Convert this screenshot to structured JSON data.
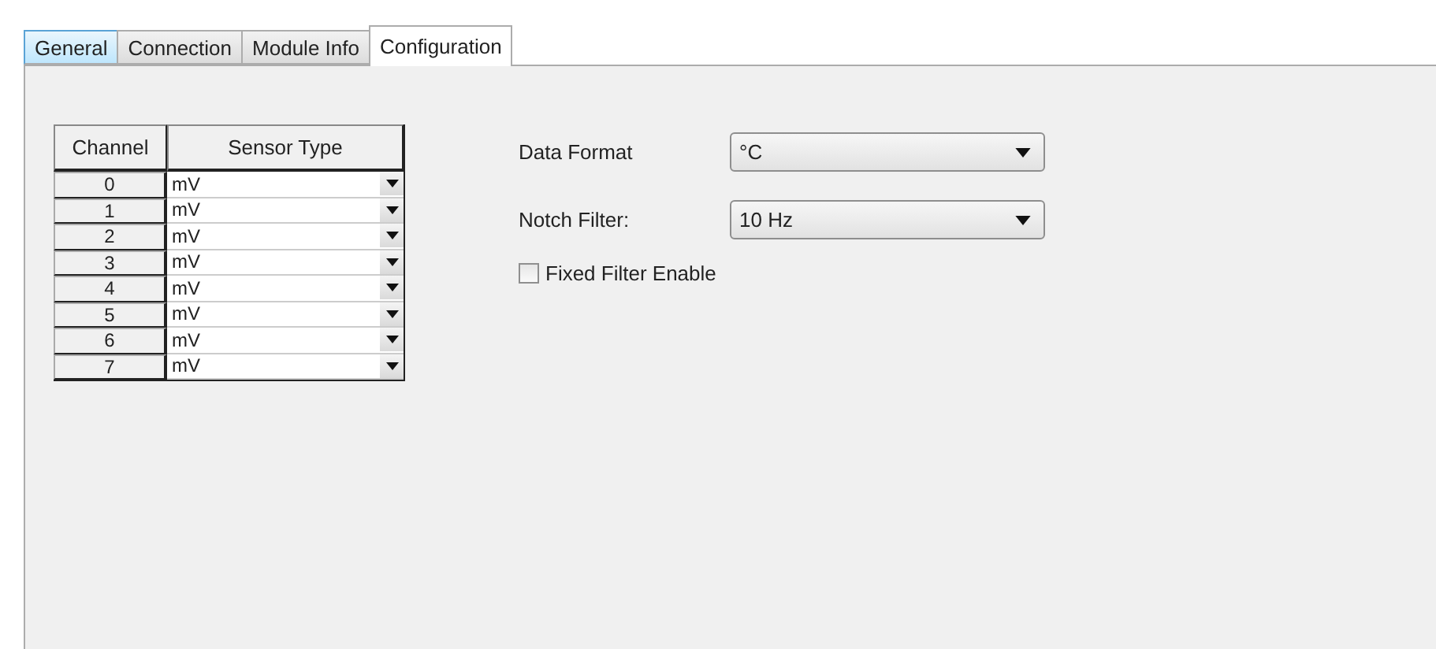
{
  "tabs": [
    {
      "label": "General",
      "selected": false,
      "highlighted": true
    },
    {
      "label": "Connection",
      "selected": false,
      "highlighted": false
    },
    {
      "label": "Module Info",
      "selected": false,
      "highlighted": false
    },
    {
      "label": "Configuration",
      "selected": true,
      "highlighted": false
    }
  ],
  "channel_table": {
    "columns": [
      "Channel",
      "Sensor Type"
    ],
    "rows": [
      {
        "channel": "0",
        "sensor_type": "mV"
      },
      {
        "channel": "1",
        "sensor_type": "mV"
      },
      {
        "channel": "2",
        "sensor_type": "mV"
      },
      {
        "channel": "3",
        "sensor_type": "mV"
      },
      {
        "channel": "4",
        "sensor_type": "mV"
      },
      {
        "channel": "5",
        "sensor_type": "mV"
      },
      {
        "channel": "6",
        "sensor_type": "mV"
      },
      {
        "channel": "7",
        "sensor_type": "mV"
      }
    ]
  },
  "settings": [
    {
      "label": "Data Format",
      "value": "°C"
    },
    {
      "label": "Notch Filter:",
      "value": "10 Hz"
    }
  ],
  "fixed_filter": {
    "label": "Fixed Filter Enable",
    "checked": false
  }
}
